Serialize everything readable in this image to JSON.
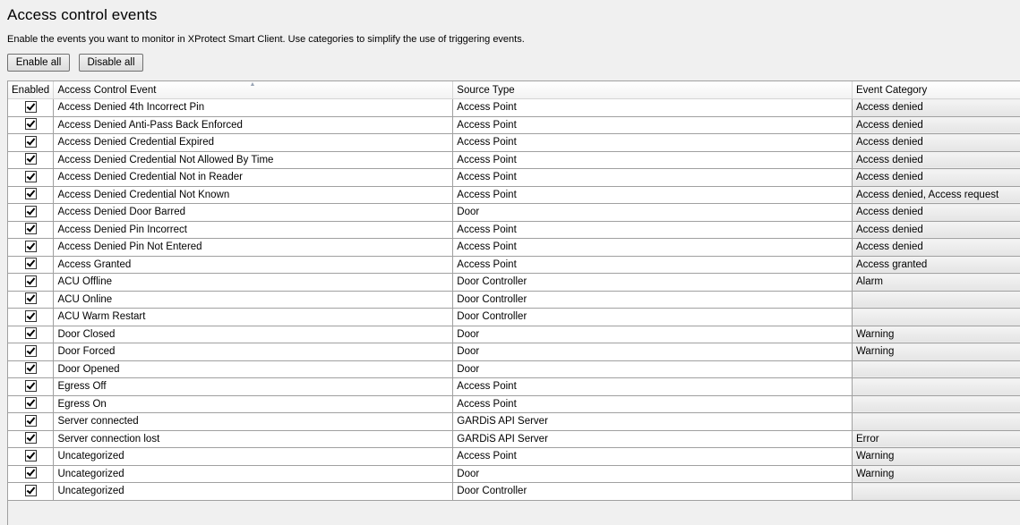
{
  "page": {
    "title": "Access control events",
    "description": "Enable the events you want to monitor in XProtect Smart Client. Use categories to simplify the use of triggering events."
  },
  "buttons": {
    "enable_all": "Enable all",
    "disable_all": "Disable all"
  },
  "table": {
    "headers": {
      "enabled": "Enabled",
      "event": "Access Control Event",
      "source": "Source Type",
      "category": "Event Category"
    },
    "sort_column": "event",
    "rows": [
      {
        "enabled": true,
        "event": "Access Denied 4th Incorrect Pin",
        "source": "Access Point",
        "category": "Access denied"
      },
      {
        "enabled": true,
        "event": "Access Denied Anti-Pass Back Enforced",
        "source": "Access Point",
        "category": "Access denied"
      },
      {
        "enabled": true,
        "event": "Access Denied Credential Expired",
        "source": "Access Point",
        "category": "Access denied"
      },
      {
        "enabled": true,
        "event": "Access Denied Credential Not Allowed By Time",
        "source": "Access Point",
        "category": "Access denied"
      },
      {
        "enabled": true,
        "event": "Access Denied Credential Not in Reader",
        "source": "Access Point",
        "category": "Access denied"
      },
      {
        "enabled": true,
        "event": "Access Denied Credential Not Known",
        "source": "Access Point",
        "category": "Access denied, Access request"
      },
      {
        "enabled": true,
        "event": "Access Denied Door Barred",
        "source": "Door",
        "category": "Access denied"
      },
      {
        "enabled": true,
        "event": "Access Denied Pin Incorrect",
        "source": "Access Point",
        "category": "Access denied"
      },
      {
        "enabled": true,
        "event": "Access Denied Pin Not Entered",
        "source": "Access Point",
        "category": "Access denied"
      },
      {
        "enabled": true,
        "event": "Access Granted",
        "source": "Access Point",
        "category": "Access granted"
      },
      {
        "enabled": true,
        "event": "ACU Offline",
        "source": "Door Controller",
        "category": "Alarm"
      },
      {
        "enabled": true,
        "event": "ACU Online",
        "source": "Door Controller",
        "category": ""
      },
      {
        "enabled": true,
        "event": "ACU Warm Restart",
        "source": "Door Controller",
        "category": ""
      },
      {
        "enabled": true,
        "event": "Door Closed",
        "source": "Door",
        "category": "Warning"
      },
      {
        "enabled": true,
        "event": "Door Forced",
        "source": "Door",
        "category": "Warning"
      },
      {
        "enabled": true,
        "event": "Door Opened",
        "source": "Door",
        "category": ""
      },
      {
        "enabled": true,
        "event": "Egress Off",
        "source": "Access Point",
        "category": ""
      },
      {
        "enabled": true,
        "event": "Egress On",
        "source": "Access Point",
        "category": ""
      },
      {
        "enabled": true,
        "event": "Server connected",
        "source": "GARDiS API Server",
        "category": ""
      },
      {
        "enabled": true,
        "event": "Server connection lost",
        "source": "GARDiS API Server",
        "category": "Error"
      },
      {
        "enabled": true,
        "event": "Uncategorized",
        "source": "Access Point",
        "category": "Warning"
      },
      {
        "enabled": true,
        "event": "Uncategorized",
        "source": "Door",
        "category": "Warning"
      },
      {
        "enabled": true,
        "event": "Uncategorized",
        "source": "Door Controller",
        "category": ""
      }
    ]
  }
}
